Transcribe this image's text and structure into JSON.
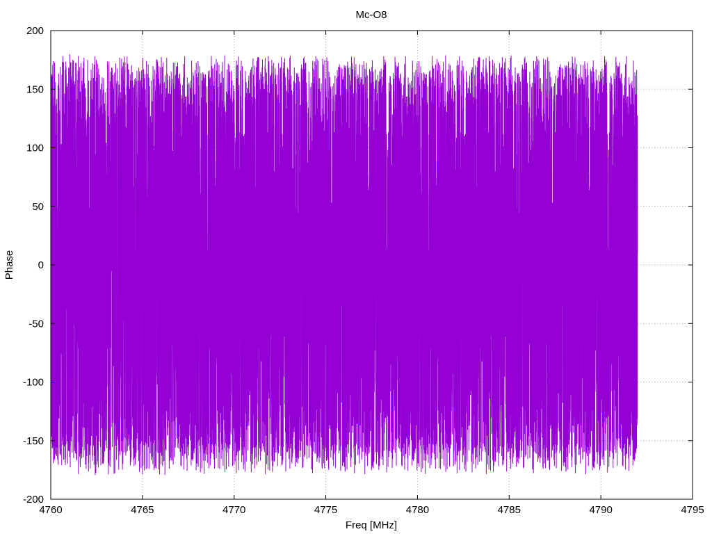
{
  "chart_data": {
    "type": "line",
    "title": "Mc-O8",
    "xlabel": "Freq [MHz]",
    "ylabel": "Phase",
    "xlim": [
      4760,
      4795
    ],
    "ylim": [
      -200,
      200
    ],
    "x_ticks": [
      4760,
      4765,
      4770,
      4775,
      4780,
      4785,
      4790,
      4795
    ],
    "y_ticks": [
      -200,
      -150,
      -100,
      -50,
      0,
      50,
      100,
      150,
      200
    ],
    "grid": true,
    "series": [
      {
        "color": "#9400d3",
        "x_range": [
          4760,
          4792
        ],
        "value_range": [
          -180,
          180
        ],
        "pattern": "dense random phase oscillation between -180 and 180 across 4760 to 4792 MHz"
      }
    ]
  }
}
